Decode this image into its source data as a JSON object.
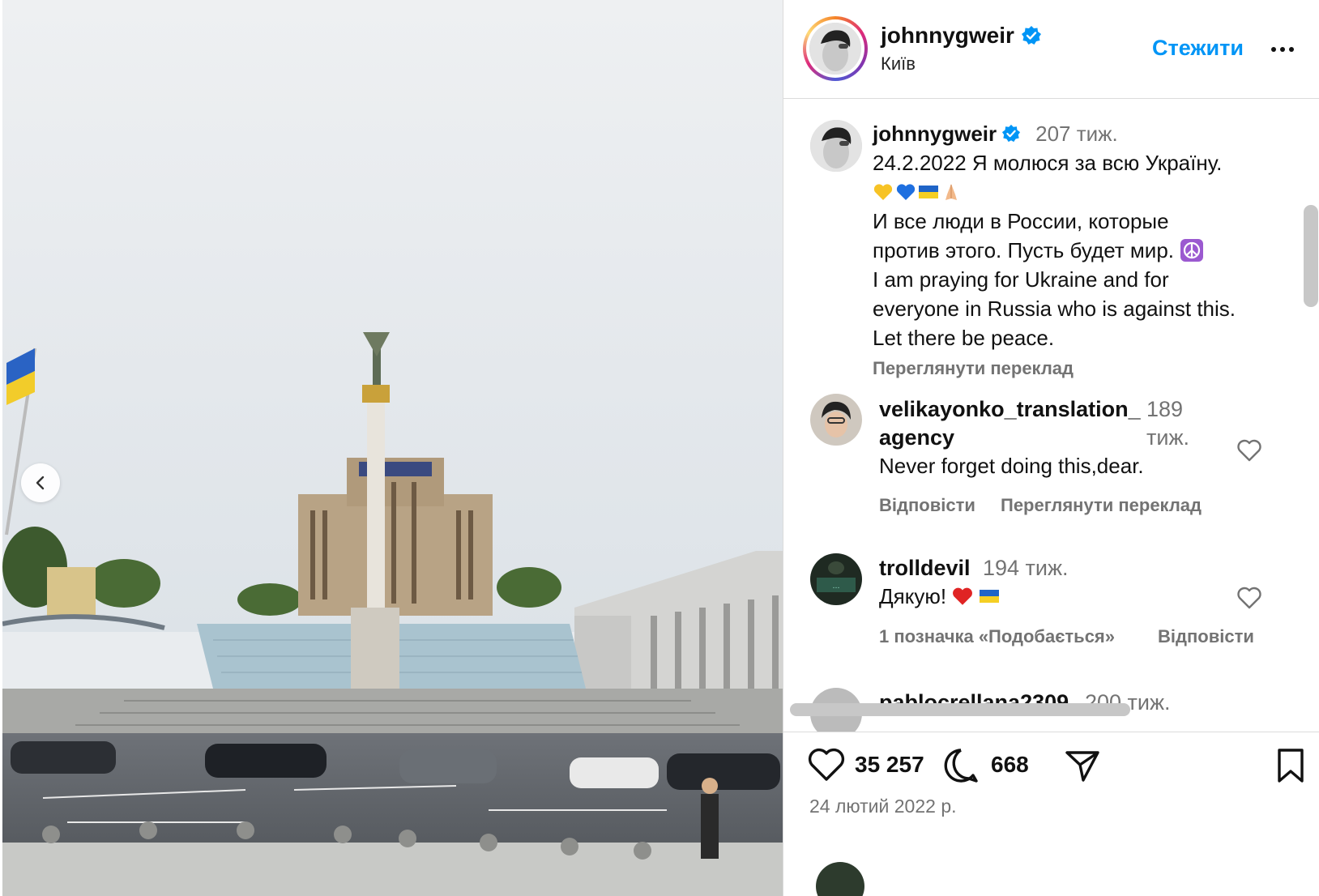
{
  "post": {
    "username": "johnnygweir",
    "location": "Київ",
    "follow_label": "Стежити",
    "caption": {
      "time": "207 тиж.",
      "lines": [
        "24.2.2022 Я молюся за всю Україну.",
        "И все люди в России, которые",
        "против этого. Пусть будет мир.",
        "I am praying for Ukraine and for",
        "everyone in Russia who is against this.",
        "Let there be peace."
      ],
      "see_translation": "Переглянути переклад"
    },
    "comments": [
      {
        "username_line1": "velikayonko_translation_",
        "username_line2": "agency",
        "time_line1": "189",
        "time_line2": "тиж.",
        "text": "Never forget doing this,dear.",
        "reply": "Відповісти",
        "see_translation": "Переглянути переклад"
      },
      {
        "username": "trolldevil",
        "time": "194 тиж.",
        "text": "Дякую!",
        "likes": "1 позначка «Подобається»",
        "reply": "Відповісти"
      },
      {
        "username": "pablocrellana2309",
        "time": "200 тиж."
      }
    ],
    "likes_count": "35 257",
    "comments_count": "668",
    "date": "24 лютий 2022 р."
  },
  "colors": {
    "accent": "#0095f6",
    "muted": "#737373",
    "verified": "#0095f6"
  },
  "icons": {
    "prev": "chevron-left-icon",
    "more": "more-icon",
    "verified": "verified-icon",
    "like": "heart-icon",
    "comment": "comment-icon",
    "share": "share-icon",
    "save": "bookmark-icon"
  }
}
